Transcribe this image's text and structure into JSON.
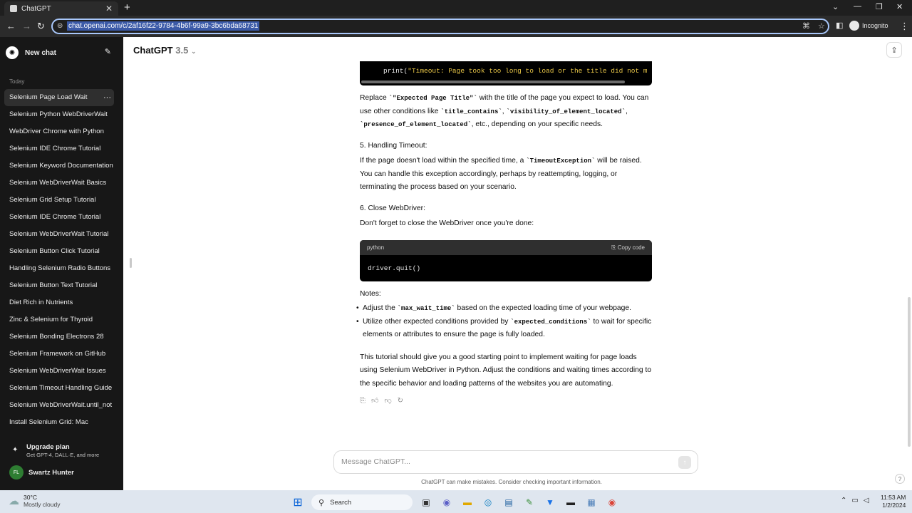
{
  "browser": {
    "tab_title": "ChatGPT",
    "url": "chat.openai.com/c/2af16f22-9784-4b6f-99a9-3bc6bda68731",
    "profile": "Incognito"
  },
  "sidebar": {
    "new_chat": "New chat",
    "section": "Today",
    "items": [
      "Selenium Page Load Wait",
      "Selenium Python WebDriverWait",
      "WebDriver Chrome with Python",
      "Selenium IDE Chrome Tutorial",
      "Selenium Keyword Documentation",
      "Selenium WebDriverWait Basics",
      "Selenium Grid Setup Tutorial",
      "Selenium IDE Chrome Tutorial",
      "Selenium WebDriverWait Tutorial",
      "Selenium Button Click Tutorial",
      "Handling Selenium Radio Buttons",
      "Selenium Button Text Tutorial",
      "Diet Rich in Nutrients",
      "Zinc & Selenium for Thyroid",
      "Selenium Bonding Electrons 28",
      "Selenium Framework on GitHub",
      "Selenium WebDriverWait Issues",
      "Selenium Timeout Handling Guide",
      "Selenium WebDriverWait.until_not",
      "Install Selenium Grid: Mac"
    ],
    "upgrade_title": "Upgrade plan",
    "upgrade_sub": "Get GPT-4, DALL·E, and more",
    "user_initials": "FL",
    "user_name": "Swartz Hunter"
  },
  "header": {
    "model": "ChatGPT",
    "version": "3.5"
  },
  "message": {
    "code_top_fn": "print(",
    "code_top_str": "\"Timeout: Page took too long to load or the title did not mat",
    "p1_a": "Replace ",
    "p1_code1": "`\"Expected Page Title\"`",
    "p1_b": " with the title of the page you expect to load. You can use other conditions like ",
    "p1_code2": "`title_contains`",
    "p1_c": ", ",
    "p1_code3": "`visibility_of_element_located`",
    "p1_d": ", ",
    "p1_code4": "`presence_of_element_located`",
    "p1_e": ", etc., depending on your specific needs.",
    "h5": "5. Handling Timeout:",
    "p2_a": "If the page doesn't load within the specified time, a ",
    "p2_code": "`TimeoutException`",
    "p2_b": " will be raised. You can handle this exception accordingly, perhaps by reattempting, logging, or terminating the process based on your scenario.",
    "h6": "6. Close WebDriver:",
    "p3": "Don't forget to close the WebDriver once you're done:",
    "code_lang": "python",
    "copy_label": "Copy code",
    "code_body": "driver.quit()",
    "notes": "Notes:",
    "b1_a": "Adjust the ",
    "b1_code": "`max_wait_time`",
    "b1_b": " based on the expected loading time of your webpage.",
    "b2_a": "Utilize other expected conditions provided by ",
    "b2_code": "`expected_conditions`",
    "b2_b": " to wait for specific elements or attributes to ensure the page is fully loaded.",
    "p4": "This tutorial should give you a good starting point to implement waiting for page loads using Selenium WebDriver in Python. Adjust the conditions and waiting times according to the specific behavior and loading patterns of the websites you are automating."
  },
  "composer": {
    "placeholder": "Message ChatGPT..."
  },
  "disclaimer": "ChatGPT can make mistakes. Consider checking important information.",
  "taskbar": {
    "temp": "30°C",
    "weather": "Mostly cloudy",
    "search": "Search",
    "time": "11:53 AM",
    "date": "1/2/2024"
  }
}
